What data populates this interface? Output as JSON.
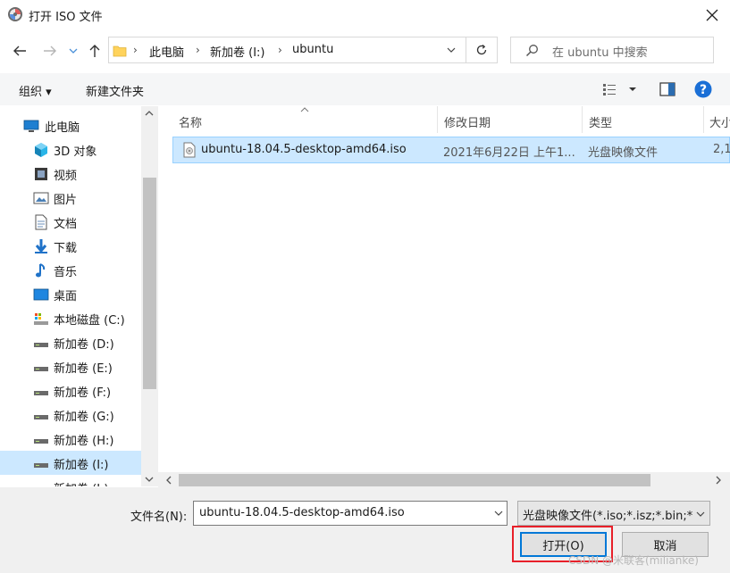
{
  "window": {
    "title": "打开 ISO 文件"
  },
  "address_bar": {
    "crumbs": [
      "此电脑",
      "新加卷 (I:)",
      "ubuntu"
    ]
  },
  "search": {
    "placeholder": "在 ubuntu 中搜索"
  },
  "toolbar": {
    "organize_label": "组织 ▾",
    "new_folder_label": "新建文件夹"
  },
  "sidebar": {
    "items": [
      {
        "label": "此电脑",
        "icon": "computer-icon"
      },
      {
        "label": "3D 对象",
        "icon": "3d-objects-icon"
      },
      {
        "label": "视频",
        "icon": "video-icon"
      },
      {
        "label": "图片",
        "icon": "pictures-icon"
      },
      {
        "label": "文档",
        "icon": "documents-icon"
      },
      {
        "label": "下载",
        "icon": "download-icon"
      },
      {
        "label": "音乐",
        "icon": "music-icon"
      },
      {
        "label": "桌面",
        "icon": "desktop-icon"
      },
      {
        "label": "本地磁盘 (C:)",
        "icon": "system-drive-icon"
      },
      {
        "label": "新加卷 (D:)",
        "icon": "drive-icon"
      },
      {
        "label": "新加卷 (E:)",
        "icon": "drive-icon"
      },
      {
        "label": "新加卷 (F:)",
        "icon": "drive-icon"
      },
      {
        "label": "新加卷 (G:)",
        "icon": "drive-icon"
      },
      {
        "label": "新加卷 (H:)",
        "icon": "drive-icon"
      },
      {
        "label": "新加卷 (I:)",
        "icon": "drive-icon",
        "selected": true
      },
      {
        "label": "新加卷 (J:)",
        "icon": "drive-icon"
      }
    ]
  },
  "file_list": {
    "columns": [
      "名称",
      "修改日期",
      "类型",
      "大小"
    ],
    "rows": [
      {
        "name": "ubuntu-18.04.5-desktop-amd64.iso",
        "modified": "2021年6月22日 上午1...",
        "type": "光盘映像文件",
        "size": "2,1"
      }
    ]
  },
  "bottom": {
    "filename_label": "文件名(N):",
    "filename_value": "ubuntu-18.04.5-desktop-amd64.iso",
    "filter_value": "光盘映像文件(*.iso;*.isz;*.bin;*",
    "open_label": "打开(O)",
    "cancel_label": "取消"
  },
  "watermark": "CSDN @米联客(milianke)",
  "colors": {
    "selection": "#cce8ff",
    "accent": "#0078d7",
    "highlight": "#e8202a"
  }
}
